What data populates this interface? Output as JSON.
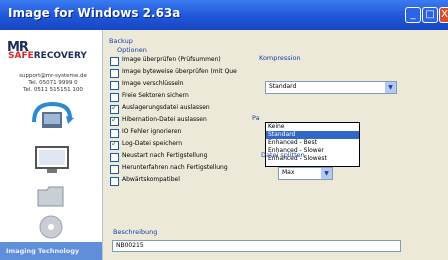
{
  "window": {
    "title": "Image for Windows 2.63a",
    "min_label": "_",
    "max_label": "□",
    "close_label": "X"
  },
  "sidebar": {
    "logo_mr": "MR",
    "logo_safe": "SAFE",
    "logo_recovery": "RECOVERY",
    "contact_lines": [
      "support@mr-systeme.de",
      "Tel. 05071 9999 0",
      "Tel. 0511 515151 100"
    ],
    "bottom_label": "Imaging Technology"
  },
  "backup": {
    "section_label": "Backup",
    "options_label": "Optionen",
    "options": [
      {
        "label": "Image überprüfen (Prüfsummen)",
        "checked": false
      },
      {
        "label": "Image byteweise überprüfen (mit Que",
        "checked": false
      },
      {
        "label": "Image verschlüsseln",
        "checked": false
      },
      {
        "label": "Freie Sektoren sichern",
        "checked": false
      },
      {
        "label": "Auslagerungsdatei auslassen",
        "checked": true
      },
      {
        "label": "Hibernation-Datei auslassen",
        "checked": true
      },
      {
        "label": "IO Fehler ignorieren",
        "checked": false
      },
      {
        "label": "Log-Datei speichern",
        "checked": true
      },
      {
        "label": "Neustart nach Fertigstellung",
        "checked": false
      },
      {
        "label": "Herunterfahren nach Fertigstellung",
        "checked": false
      },
      {
        "label": "Abwärtskompatibel",
        "checked": false
      }
    ],
    "compression_label": "Kompression",
    "compression_value": "Standard",
    "compression_options": [
      "Keine",
      "Standard",
      "Enhanced - Best",
      "Enhanced - Slower",
      "Enhanced - Slowest"
    ],
    "compression_selected_index": 1,
    "password_label_fragment": "Pa",
    "split_label": "Datei splitten",
    "split_value": "Max",
    "description_label": "Beschreibung",
    "description_value": "NB00215"
  }
}
